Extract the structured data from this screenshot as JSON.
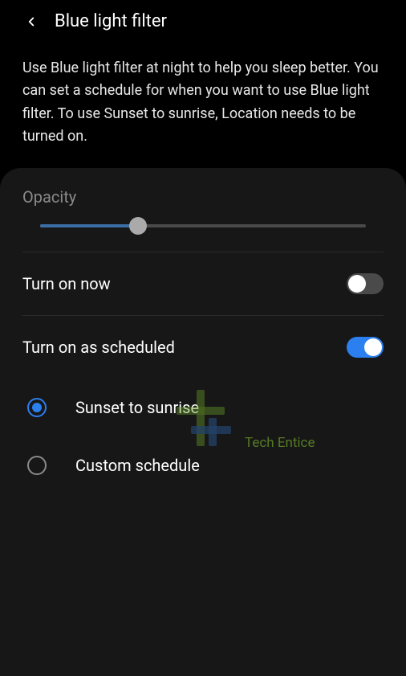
{
  "header": {
    "title": "Blue light filter"
  },
  "description": "Use Blue light filter at night to help you sleep better. You can set a schedule for when you want to use Blue light filter. To use Sunset to sunrise, Location needs to be turned on.",
  "opacity": {
    "label": "Opacity",
    "value": 30
  },
  "toggles": {
    "turn_on_now": {
      "label": "Turn on now",
      "enabled": false
    },
    "turn_on_scheduled": {
      "label": "Turn on as scheduled",
      "enabled": true
    }
  },
  "schedule_options": {
    "sunset": {
      "label": "Sunset to sunrise",
      "selected": true
    },
    "custom": {
      "label": "Custom schedule",
      "selected": false
    }
  },
  "watermark": "Tech Entice"
}
